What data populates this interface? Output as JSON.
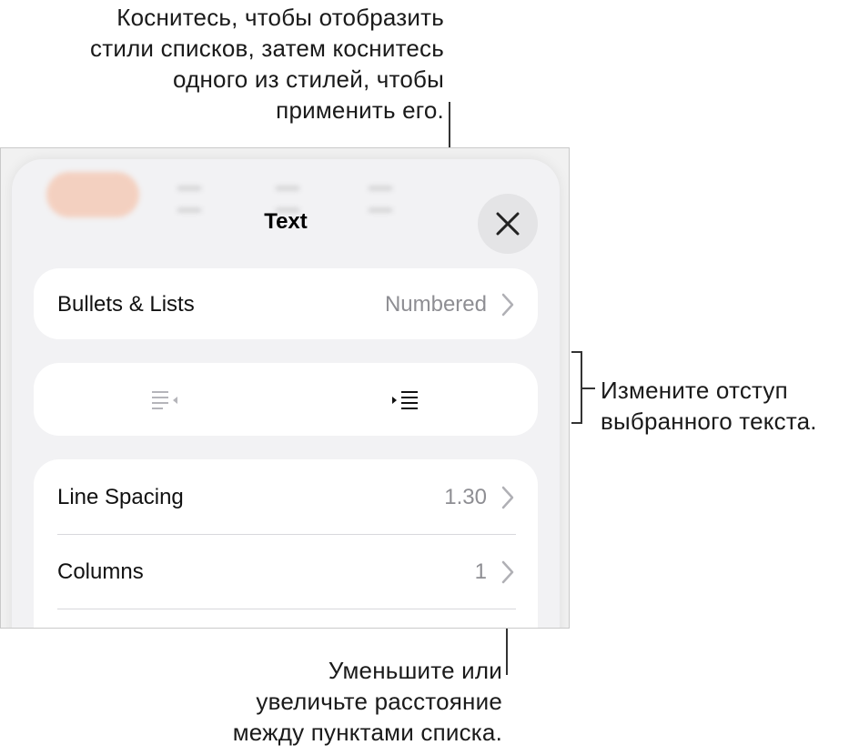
{
  "callouts": {
    "top": [
      "Коснитесь, чтобы отобразить",
      "стили списков, затем коснитесь",
      "одного из стилей, чтобы",
      "применить его."
    ],
    "right": [
      "Измените отступ",
      "выбранного текста."
    ],
    "bottom": [
      "Уменьшите или",
      "увеличьте расстояние",
      "между пунктами списка."
    ]
  },
  "panel": {
    "title": "Text",
    "close_icon": "close-icon",
    "bullets": {
      "label": "Bullets & Lists",
      "value": "Numbered"
    },
    "indent": {
      "decrease_icon": "outdent-icon",
      "increase_icon": "indent-icon"
    },
    "line_spacing": {
      "label": "Line Spacing",
      "value": "1.30"
    },
    "columns": {
      "label": "Columns",
      "value": "1"
    }
  },
  "colors": {
    "accent": "#f6a882",
    "panel_bg": "#f2f2f4",
    "secondary_text": "#8e8e93"
  }
}
